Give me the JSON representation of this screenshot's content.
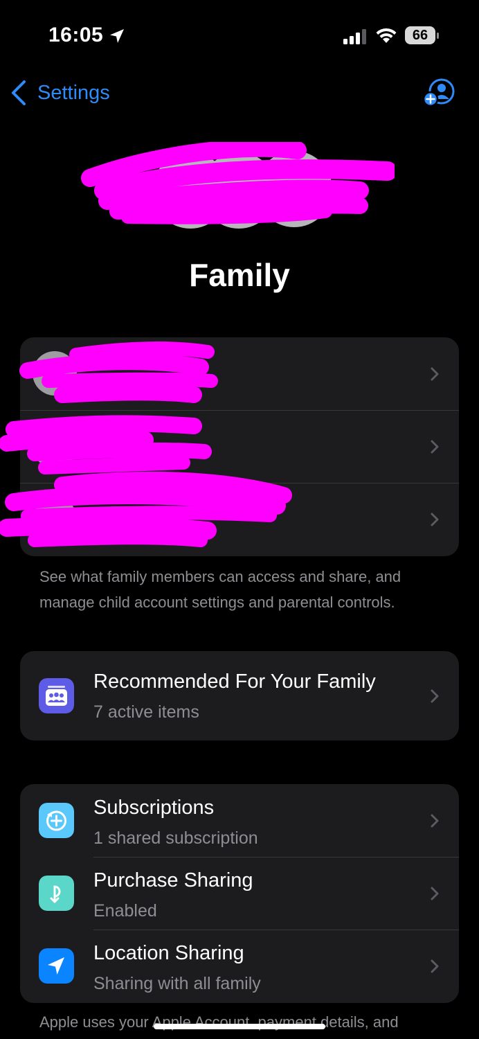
{
  "status_bar": {
    "time": "16:05",
    "battery": "66"
  },
  "nav": {
    "back_label": "Settings"
  },
  "title": "Family",
  "members_card": {
    "rows": [
      {
        "name": ""
      },
      {
        "name": ""
      },
      {
        "name": ""
      }
    ]
  },
  "members_footer": "See what family members can access and share, and manage child account settings and parental controls.",
  "recommended": {
    "title": "Recommended For Your Family",
    "subtitle": "7 active items"
  },
  "services": [
    {
      "title": "Subscriptions",
      "subtitle": "1 shared subscription",
      "icon": "subscriptions-icon",
      "color": "#5ac8fa"
    },
    {
      "title": "Purchase Sharing",
      "subtitle": "Enabled",
      "icon": "purchase-sharing-icon",
      "color": "#5ad7c8"
    },
    {
      "title": "Location Sharing",
      "subtitle": "Sharing with all family",
      "icon": "location-arrow-icon",
      "color": "#0a84ff"
    }
  ],
  "bottom_footer": "Apple uses your Apple Account, payment details, and",
  "colors": {
    "accent": "#2e8bf8",
    "redaction": "#ff00ff",
    "card_bg": "#1c1c1e"
  }
}
